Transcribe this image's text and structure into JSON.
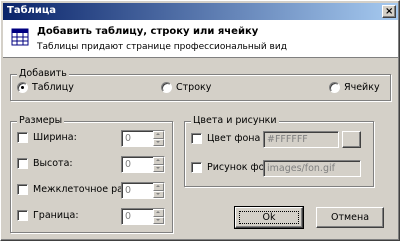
{
  "window": {
    "title": "Таблица",
    "close_glyph": "×"
  },
  "header": {
    "icon": "table-icon",
    "title": "Добавить таблицу, строку или ячейку",
    "subtitle": "Таблицы придают странице профессиональный вид"
  },
  "add_group": {
    "legend": "Добавить",
    "options": [
      {
        "label": "Таблицу",
        "checked": true
      },
      {
        "label": "Строку",
        "checked": false
      },
      {
        "label": "Ячейку",
        "checked": false
      }
    ]
  },
  "sizes_group": {
    "legend": "Размеры",
    "rows": [
      {
        "label": "Ширина:",
        "value": "0"
      },
      {
        "label": "Высота:",
        "value": "0"
      },
      {
        "label": "Межклеточное расст.:",
        "value": "0"
      },
      {
        "label": "Граница:",
        "value": "0"
      }
    ]
  },
  "colors_group": {
    "legend": "Цвета и рисунки",
    "bg_color_label": "Цвет фона",
    "bg_color_value": "#FFFFFF",
    "bg_image_label": "Рисунок фона",
    "bg_image_value": "images/fon.gif"
  },
  "buttons": {
    "ok": "Ok",
    "cancel": "Отмена"
  },
  "colors": {
    "titlebar_start": "#0a246a",
    "titlebar_end": "#a6caf0",
    "face": "#d4d0c8"
  }
}
